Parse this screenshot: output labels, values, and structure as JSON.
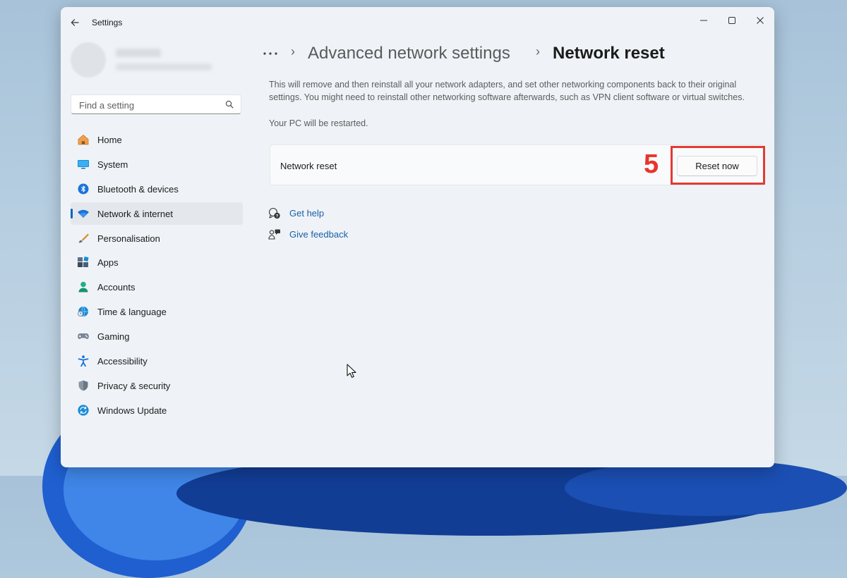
{
  "window": {
    "app_title": "Settings"
  },
  "sidebar": {
    "search": {
      "placeholder": "Find a setting"
    },
    "items": [
      {
        "label": "Home",
        "icon": "home-icon"
      },
      {
        "label": "System",
        "icon": "system-icon"
      },
      {
        "label": "Bluetooth & devices",
        "icon": "bluetooth-icon"
      },
      {
        "label": "Network & internet",
        "icon": "wifi-icon",
        "selected": true
      },
      {
        "label": "Personalisation",
        "icon": "brush-icon"
      },
      {
        "label": "Apps",
        "icon": "apps-icon"
      },
      {
        "label": "Accounts",
        "icon": "accounts-icon"
      },
      {
        "label": "Time & language",
        "icon": "globe-clock-icon"
      },
      {
        "label": "Gaming",
        "icon": "gamepad-icon"
      },
      {
        "label": "Accessibility",
        "icon": "accessibility-icon"
      },
      {
        "label": "Privacy & security",
        "icon": "shield-icon"
      },
      {
        "label": "Windows Update",
        "icon": "update-icon"
      }
    ]
  },
  "breadcrumb": {
    "parent": "Advanced network settings",
    "current": "Network reset"
  },
  "main": {
    "description": "This will remove and then reinstall all your network adapters, and set other networking components back to their original settings. You might need to reinstall other networking software afterwards, such as VPN client software or virtual switches.",
    "restart_note": "Your PC will be restarted.",
    "card": {
      "label": "Network reset",
      "button_label": "Reset now"
    },
    "annotation": {
      "step_number": "5",
      "color": "#e23a33"
    },
    "links": {
      "help": "Get help",
      "feedback": "Give feedback"
    }
  },
  "colors": {
    "accent": "#0067c0",
    "link": "#1a5fa8",
    "window_bg": "#eff3f7"
  }
}
